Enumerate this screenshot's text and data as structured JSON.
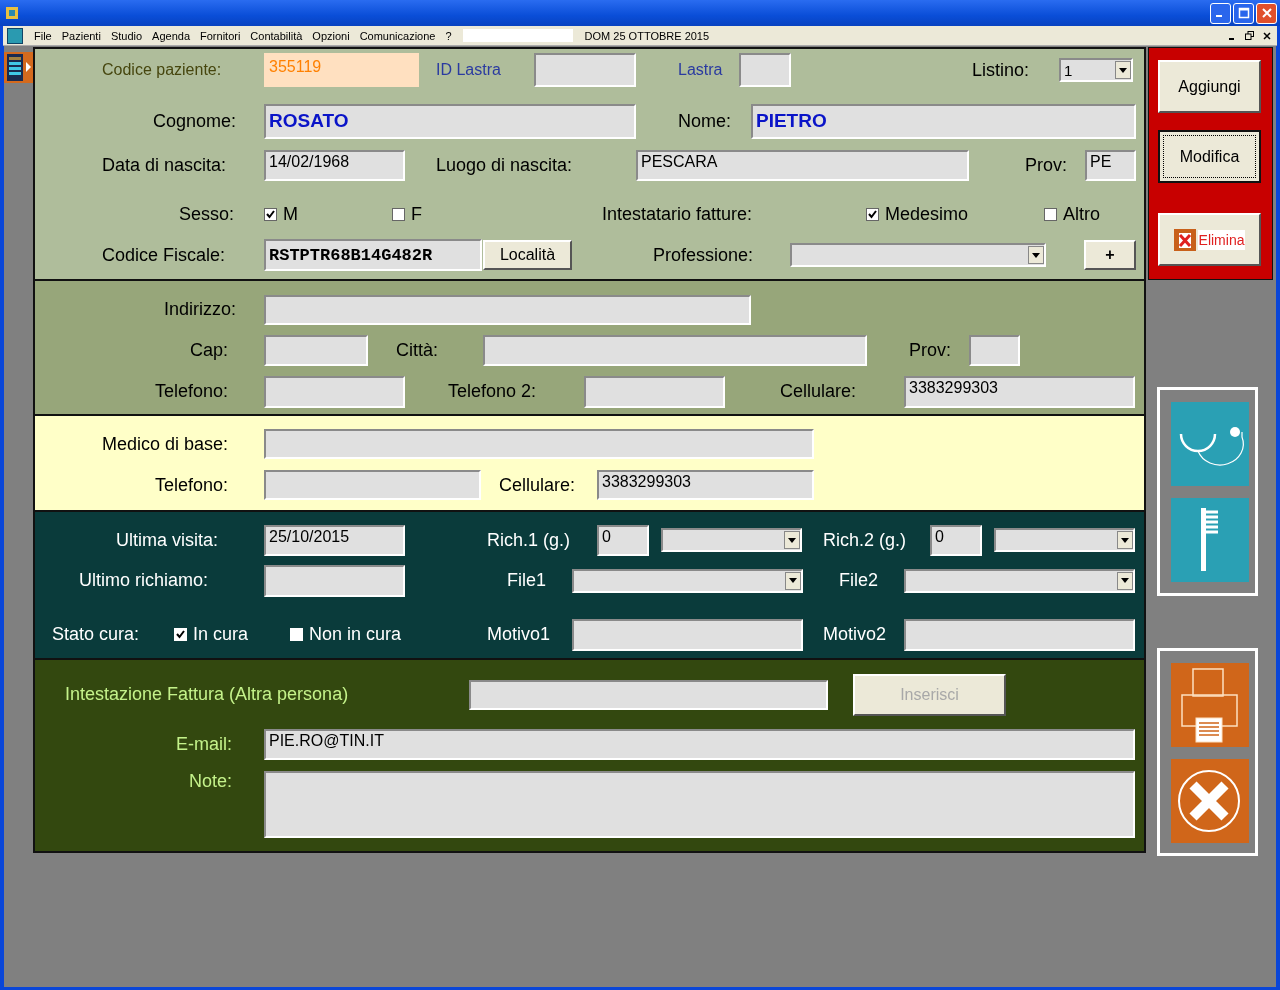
{
  "menu": [
    "File",
    "Pazienti",
    "Studio",
    "Agenda",
    "Fornitori",
    "Contabilità",
    "Opzioni",
    "Comunicazione",
    "?"
  ],
  "date": "DOM 25 OTTOBRE 2015",
  "sections": [
    {
      "items": [
        {
          "kind": "code-label",
          "text": "Codice paziente:"
        },
        {
          "kind": "id-field",
          "value": "355119"
        },
        {
          "kind": "small-label",
          "text": "ID Lastra"
        },
        {
          "kind": "field"
        },
        {
          "kind": "small-label",
          "text": "Lastra"
        },
        {
          "kind": "field"
        },
        {
          "kind": "label",
          "text": "Listino:"
        },
        {
          "kind": "combo",
          "value": "1"
        },
        {
          "kind": "label",
          "text": "Cognome:"
        },
        {
          "kind": "name-field",
          "value": "ROSATO"
        },
        {
          "kind": "label",
          "text": "Nome:"
        },
        {
          "kind": "name-field",
          "value": "PIETRO"
        },
        {
          "kind": "label",
          "text": "Data di nascita:"
        },
        {
          "kind": "field",
          "value": "14/02/1968"
        },
        {
          "kind": "label",
          "text": "Luogo di nascita:"
        },
        {
          "kind": "field",
          "value": "PESCARA"
        },
        {
          "kind": "label",
          "text": "Prov:"
        },
        {
          "kind": "field",
          "value": "PE"
        },
        {
          "kind": "label",
          "text": "Sesso:"
        },
        {
          "kind": "check",
          "text": "M",
          "checked": true
        },
        {
          "kind": "check",
          "text": "F",
          "checked": false
        },
        {
          "kind": "label",
          "text": "Intestatario fatture:"
        },
        {
          "kind": "check",
          "text": "Medesimo",
          "checked": true
        },
        {
          "kind": "check",
          "text": "Altro",
          "checked": false
        },
        {
          "kind": "label",
          "text": "Codice Fiscale:"
        },
        {
          "kind": "code-field",
          "value": "RSTPTR68B14G482R"
        },
        {
          "kind": "button",
          "text": "Località"
        },
        {
          "kind": "label",
          "text": "Professione:"
        },
        {
          "kind": "combo"
        },
        {
          "kind": "button",
          "text": "+"
        }
      ]
    },
    {
      "items": [
        {
          "kind": "label",
          "text": "Indirizzo:"
        },
        {
          "kind": "field"
        },
        {
          "kind": "label",
          "text": "Cap:"
        },
        {
          "kind": "field"
        },
        {
          "kind": "label",
          "text": "Città:"
        },
        {
          "kind": "field"
        },
        {
          "kind": "label",
          "text": "Prov:"
        },
        {
          "kind": "field"
        },
        {
          "kind": "label",
          "text": "Telefono:"
        },
        {
          "kind": "field"
        },
        {
          "kind": "label",
          "text": "Telefono 2:"
        },
        {
          "kind": "field"
        },
        {
          "kind": "label",
          "text": "Cellulare:"
        },
        {
          "kind": "field",
          "value": "3383299303"
        }
      ]
    },
    {
      "items": [
        {
          "kind": "label",
          "text": "Medico di base:"
        },
        {
          "kind": "field"
        },
        {
          "kind": "label",
          "text": "Telefono:"
        },
        {
          "kind": "field"
        },
        {
          "kind": "label",
          "text": "Cellulare:"
        },
        {
          "kind": "field",
          "value": "3383299303"
        }
      ]
    },
    {
      "items": [
        {
          "kind": "label",
          "text": "Ultima visita:"
        },
        {
          "kind": "field",
          "value": "25/10/2015"
        },
        {
          "kind": "label",
          "text": "Rich.1 (g.)"
        },
        {
          "kind": "field",
          "value": "0"
        },
        {
          "kind": "combo"
        },
        {
          "kind": "label",
          "text": "Rich.2 (g.)"
        },
        {
          "kind": "field",
          "value": "0"
        },
        {
          "kind": "combo"
        },
        {
          "kind": "label",
          "text": "Ultimo richiamo:"
        },
        {
          "kind": "field"
        },
        {
          "kind": "label",
          "text": "File1"
        },
        {
          "kind": "combo"
        },
        {
          "kind": "label",
          "text": "File2"
        },
        {
          "kind": "combo"
        },
        {
          "kind": "label",
          "text": "Stato cura:"
        },
        {
          "kind": "check",
          "text": "In cura",
          "checked": true
        },
        {
          "kind": "check",
          "text": "Non in cura",
          "checked": false
        },
        {
          "kind": "label",
          "text": "Motivo1"
        },
        {
          "kind": "field"
        },
        {
          "kind": "label",
          "text": "Motivo2"
        },
        {
          "kind": "field"
        }
      ]
    },
    {
      "items": [
        {
          "kind": "label",
          "text": "Intestazione Fattura (Altra persona)"
        },
        {
          "kind": "field"
        },
        {
          "kind": "button",
          "text": "Inserisci",
          "disabled": true
        },
        {
          "kind": "label",
          "text": "E-mail:"
        },
        {
          "kind": "field",
          "value": "PIE.RO@TIN.IT"
        },
        {
          "kind": "label",
          "text": "Note:"
        },
        {
          "kind": "field"
        }
      ]
    }
  ],
  "actions": [
    {
      "kind": "text",
      "label": "Aggiungi",
      "selected": false
    },
    {
      "kind": "text",
      "label": "Modifica",
      "selected": true
    },
    {
      "kind": "icon",
      "label": "Elimina",
      "selected": false
    }
  ]
}
